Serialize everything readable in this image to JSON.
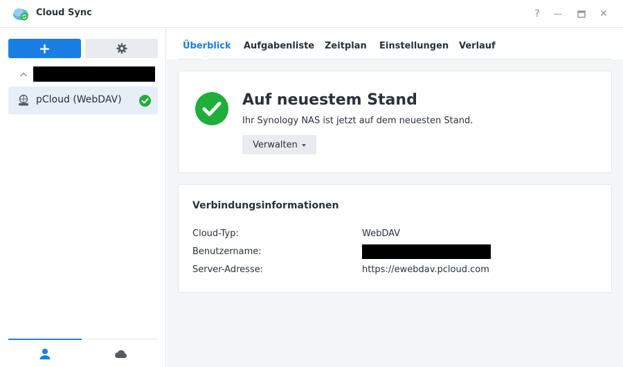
{
  "window": {
    "title": "Cloud Sync",
    "help_symbol": "?",
    "minimize_symbol": "—",
    "close_symbol": "✕"
  },
  "sidebar": {
    "add_label": "+",
    "connection": {
      "label": "pCloud (WebDAV)",
      "status": "synced"
    },
    "bottom_tabs": [
      {
        "icon": "user-icon",
        "active": true
      },
      {
        "icon": "cloud-icon",
        "active": false
      }
    ]
  },
  "tabs": [
    {
      "label": "Überblick",
      "active": true
    },
    {
      "label": "Aufgabenliste",
      "active": false
    },
    {
      "label": "Zeitplan",
      "active": false
    },
    {
      "label": "Einstellungen",
      "active": false
    },
    {
      "label": "Verlauf",
      "active": false
    }
  ],
  "status": {
    "title": "Auf neuestem Stand",
    "subtitle": "Ihr Synology NAS ist jetzt auf dem neuesten Stand.",
    "manage_label": "Verwalten"
  },
  "connection_info": {
    "title": "Verbindungsinformationen",
    "rows": [
      {
        "label": "Cloud-Typ:",
        "value": "WebDAV"
      },
      {
        "label": "Benutzername:",
        "value": ""
      },
      {
        "label": "Server-Adresse:",
        "value": "https://ewebdav.pcloud.com"
      }
    ]
  },
  "colors": {
    "accent": "#1a7fe4",
    "success": "#1fae39",
    "selected_bg": "#e6eef8"
  }
}
